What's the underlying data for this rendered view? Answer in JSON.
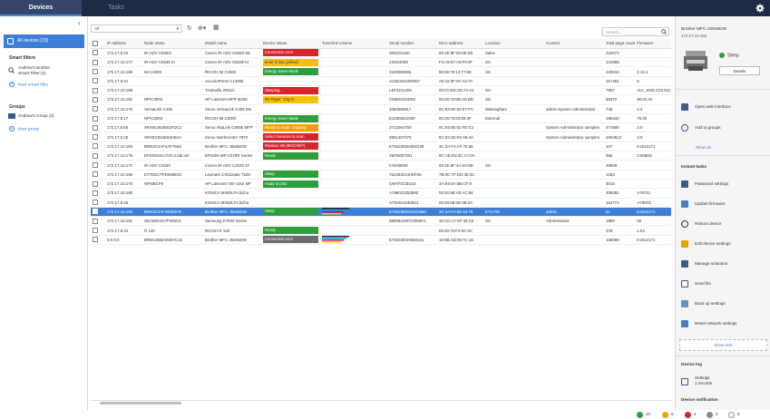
{
  "tabs": {
    "devices": "Devices",
    "tasks": "Tasks"
  },
  "sidebar": {
    "all_devices": "All devices (23)",
    "smart_filters_heading": "Smart filters",
    "smart_filter_item_line1": "Andrew's Brother",
    "smart_filter_item_line2": "Smart Filter (2)",
    "new_smart_filter": "New smart filter",
    "groups_heading": "Groups",
    "group_item": "Andrew's Group (2)",
    "new_group": "New group"
  },
  "toolbar": {
    "filter_value": "All",
    "search_placeholder": "Search..."
  },
  "table": {
    "headers": [
      "",
      "IP address",
      "Node name",
      "Model name",
      "Device status",
      "Toner/ink volume",
      "Serial number",
      "MAC address",
      "Location",
      "Contact",
      "Total page count",
      "Firmware"
    ],
    "rows": [
      {
        "ip": "172.17.8.20",
        "node": "iR-ADV C5550i",
        "model": "Canon iR-ADV C5550 SE",
        "status": "Connection error",
        "status_color": "red",
        "serial": "WWJ01440",
        "mac": "00:1E:8F:00:9E:D0",
        "location": "Sales",
        "contact": "",
        "pages": "222074",
        "fw": ""
      },
      {
        "ip": "172.17.10.177",
        "node": "iR-ADV C5535 III",
        "model": "Canon iR-ADV C5535 III",
        "status": "toner is low (yellow)",
        "status_color": "yellow",
        "serial": "2XD04409",
        "mac": "F4:A9:97:A6:F0:0F",
        "location": "SS",
        "contact": "",
        "pages": "131989",
        "fw": ""
      },
      {
        "ip": "172.17.10.189",
        "node": "IM C4500",
        "model": "RICOH IM C4500",
        "status": "Energy Saver Mode",
        "status_color": "green",
        "serial": "3100080005",
        "mac": "58:38:79:14:77:5E",
        "location": "SS",
        "contact": "",
        "pages": "225916",
        "fw": "2.10.1"
      },
      {
        "ip": "172.17.8.41",
        "node": "",
        "model": "AccurioPress C14000",
        "status": "",
        "status_color": "",
        "serial": "ACBC501000057",
        "mac": "A0:42:3F:0F:A2:7A",
        "location": "",
        "contact": "",
        "pages": "317451",
        "fw": "6"
      },
      {
        "ip": "172.17.10.188",
        "node": "",
        "model": "TASKalfa 2051ci",
        "status": "Sleeping...",
        "status_color": "red",
        "serial": "LEF4211406",
        "mac": "00:C0:EE:2D:7A:44",
        "location": "SS",
        "contact": "",
        "pages": "7997",
        "fw": "2LV_S0IS.C03.021"
      },
      {
        "ip": "172.17.10.181",
        "node": "NPIC3004",
        "model": "HP LaserJet MFP M430",
        "status": "No Paper: Tray 5",
        "status_color": "yellow",
        "serial": "CNBNKS2D08",
        "mac": "00:26:73:8D:A6:DD",
        "location": "SS",
        "contact": "",
        "pages": "55372",
        "fw": "90.01.04"
      },
      {
        "ip": "172.17.10.175",
        "node": "VersaLink C405",
        "model": "Xerox VersaLink C405 DN",
        "status": "",
        "status_color": "",
        "serial": "3350080817",
        "mac": "9C:93:4E:62:E7:FC",
        "location": "Walsingham",
        "contact": "admin System Administrator",
        "pages": "748",
        "fw": "4.2"
      },
      {
        "ip": "172.17.8.17",
        "node": "NPIC2003",
        "model": "RICOH IM C2000",
        "status": "Energy Saver Mode",
        "status_color": "green",
        "serial": "E153M421000",
        "mac": "00:26:73:63:89:3F",
        "location": "External",
        "contact": "",
        "pages": "196442",
        "fw": "79.00"
      },
      {
        "ip": "172.17.8.65",
        "node": "XRX9C934E62FDC2",
        "model": "Xerox AltaLink C8055 MFP",
        "status": "Ready to Scan, Copying",
        "status_color": "orange",
        "serial": "3712264793",
        "mac": "9C:93:4E:62:FD:C2",
        "location": "",
        "contact": "System Administrator samples",
        "pages": "471680",
        "fw": "3.0"
      },
      {
        "ip": "172.17.0.25",
        "node": "XRX9C934E63AB4A",
        "model": "Xerox WorkCentre 7970",
        "status": "Select Services to scan",
        "status_color": "red",
        "serial": "3901407376",
        "mac": "9C:93:4E:63:AB:4A",
        "location": "",
        "contact": "System Administrator samples",
        "pages": "1054912",
        "fw": "3.0"
      },
      {
        "ip": "172.17.10.183",
        "node": "BRN3C2AF4AF7565",
        "model": "Brother MFC-J5845DW",
        "status": "Replace Ink (BK/C/M/Y)",
        "status_color": "red",
        "serial": "E78322E8H350139",
        "mac": "3C:2A:F4:AF:75:65",
        "location": "",
        "contact": "",
        "pages": "107",
        "fw": "K1912171"
      },
      {
        "ip": "172.17.10.176",
        "node": "EPSON4CA70A.s.lab.net",
        "model": "EPSON WF-C579R Series",
        "status": "Ready",
        "status_color": "green",
        "serial": "X5FN007251",
        "mac": "9C:AE:D3:4C:A7:0A",
        "location": "",
        "contact": "",
        "pages": "555",
        "fw": "CS05K9"
      },
      {
        "ip": "172.17.10.171",
        "node": "iR-ADV C2020",
        "model": "Canon iR-ADV C2020 37",
        "status": "",
        "status_color": "",
        "serial": "FAK00808",
        "mac": "00:1E:8F:4A:5A:8D",
        "location": "SS",
        "contact": "",
        "pages": "49849",
        "fw": ""
      },
      {
        "ip": "172.17.10.186",
        "node": "ET7DECTFD045E3C",
        "model": "Lexmark CX622ade 7528",
        "status": "Sleep",
        "status_color": "green",
        "serial": "752283214H5FSK",
        "mac": "7B:0C:7F:DD:4E:3C",
        "location": "",
        "contact": "",
        "pages": "1253",
        "fw": ""
      },
      {
        "ip": "172.17.10.170",
        "node": "NPI6BCF9",
        "model": "HP LaserJet 700 color MF",
        "status": "ready to print",
        "status_color": "green",
        "serial": "CNHTGCB1S3",
        "mac": "3A:E6:6A:6B:CF:9",
        "location": "",
        "contact": "",
        "pages": "3016",
        "fw": ""
      },
      {
        "ip": "172.17.10.189",
        "node": "",
        "model": "KONICA MINOLTA bizhu",
        "status": "",
        "status_color": "",
        "serial": "A798021052892",
        "mac": "00:20:6B:A0:AC:84",
        "location": "",
        "contact": "",
        "pages": "308381",
        "fw": "A79711"
      },
      {
        "ip": "172.17.8.46",
        "node": "",
        "model": "KONICA MINOLTA bizhu",
        "status": "",
        "status_color": "",
        "serial": "A79H021053511",
        "mac": "00:20:6B:3E:0B:2A",
        "location": "",
        "contact": "",
        "pages": "154774",
        "fw": "A79H01"
      },
      {
        "ip": "172.17.10.183",
        "node": "BRN3C2AF4E5E578",
        "model": "Brother MFC-J5945DW",
        "status": "Sleep",
        "status_color": "green",
        "serial": "E78323E8H1921850",
        "mac": "3C:2A:F4:5E:53:78",
        "location": "KYU RE",
        "contact": "admin",
        "pages": "61",
        "fw": "K1912171",
        "selected": true
      },
      {
        "ip": "172.17.10.181",
        "node": "SEC80C0A7F646C5",
        "model": "Samsung K7500 Series",
        "status": "",
        "status_color": "",
        "serial": "08059415FC00000-L",
        "mac": "30:CD:A7:5F:46:C5",
        "location": "SS",
        "contact": "Administrator",
        "pages": "1889",
        "fw": "00"
      },
      {
        "ip": "172.17.8.22",
        "node": "R 100",
        "model": "RICOH R 100",
        "status": "Ready",
        "status_color": "green",
        "serial": "",
        "mac": "00:20:73:F2:0C:0C",
        "location": "",
        "contact": "",
        "pages": "378",
        "fw": "1.04"
      },
      {
        "ip": "0.0.0.0",
        "node": "BRW105BAD067C16",
        "model": "Brother MFC-J5845DW",
        "status": "Connection error",
        "status_color": "gray",
        "serial": "E78322E8H350151",
        "mac": "10:5B:AD:06:7C:16",
        "location": "",
        "contact": "",
        "pages": "108088",
        "fw": "K1912171"
      }
    ]
  },
  "status_counts": {
    "ok": "10",
    "warning": "5",
    "error": "4",
    "sleep": "2",
    "unknown": "5"
  },
  "status_colors": {
    "ok": "#2f9e3a",
    "warning": "#f5a000",
    "error": "#d9242b",
    "sleep": "#888888",
    "unknown": "#cccccc"
  },
  "details_panel": {
    "device_name": "Brother MFC-J5945DW",
    "device_ip": "172.17.10.183",
    "state": "Sleep",
    "details_button": "Details",
    "actions_top": [
      "Open web interface",
      "Add to groups"
    ],
    "show_all": "Show all",
    "instant_tasks_heading": "Instant tasks",
    "instant_tasks": [
      "Password settings",
      "Update firmware",
      "Reboot device",
      "Edit device settings",
      "Manage solutions",
      "Send file",
      "Back up settings",
      "Reset network settings"
    ],
    "show_less": "Show less",
    "device_log_heading": "Device log",
    "device_log_item_line1": "Settings",
    "device_log_item_line2": "1 records",
    "device_notification_heading": "Device notification"
  }
}
